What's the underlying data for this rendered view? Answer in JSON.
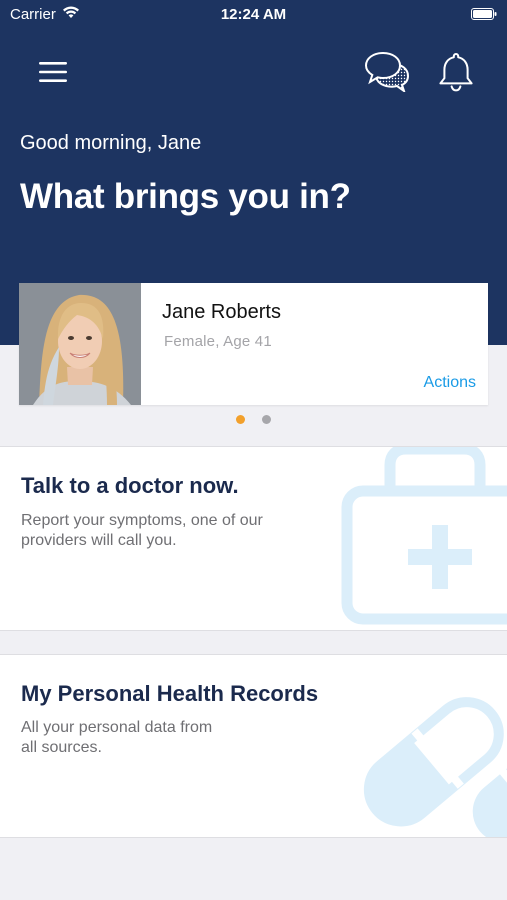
{
  "status_bar": {
    "carrier": "Carrier",
    "time": "12:24 AM"
  },
  "header": {
    "greeting": "Good morning, Jane",
    "headline": "What brings you in?"
  },
  "profile": {
    "name": "Jane Roberts",
    "meta": "Female, Age 41",
    "actions_label": "Actions"
  },
  "pager": {
    "active_index": 0,
    "count": 2
  },
  "cards": [
    {
      "title": "Talk to a doctor now.",
      "description_lines": [
        "Report your symptoms, one of our",
        "providers will call you."
      ],
      "icon": "medical-kit-icon"
    },
    {
      "title": "My Personal Health Records",
      "description_lines": [
        "All your personal data from",
        "all sources."
      ],
      "icon": "pill-icon"
    }
  ],
  "colors": {
    "header_bg": "#1d3461",
    "accent": "#1a9be6",
    "dot_active": "#f2a02b",
    "illustration": "#dbeefa"
  }
}
